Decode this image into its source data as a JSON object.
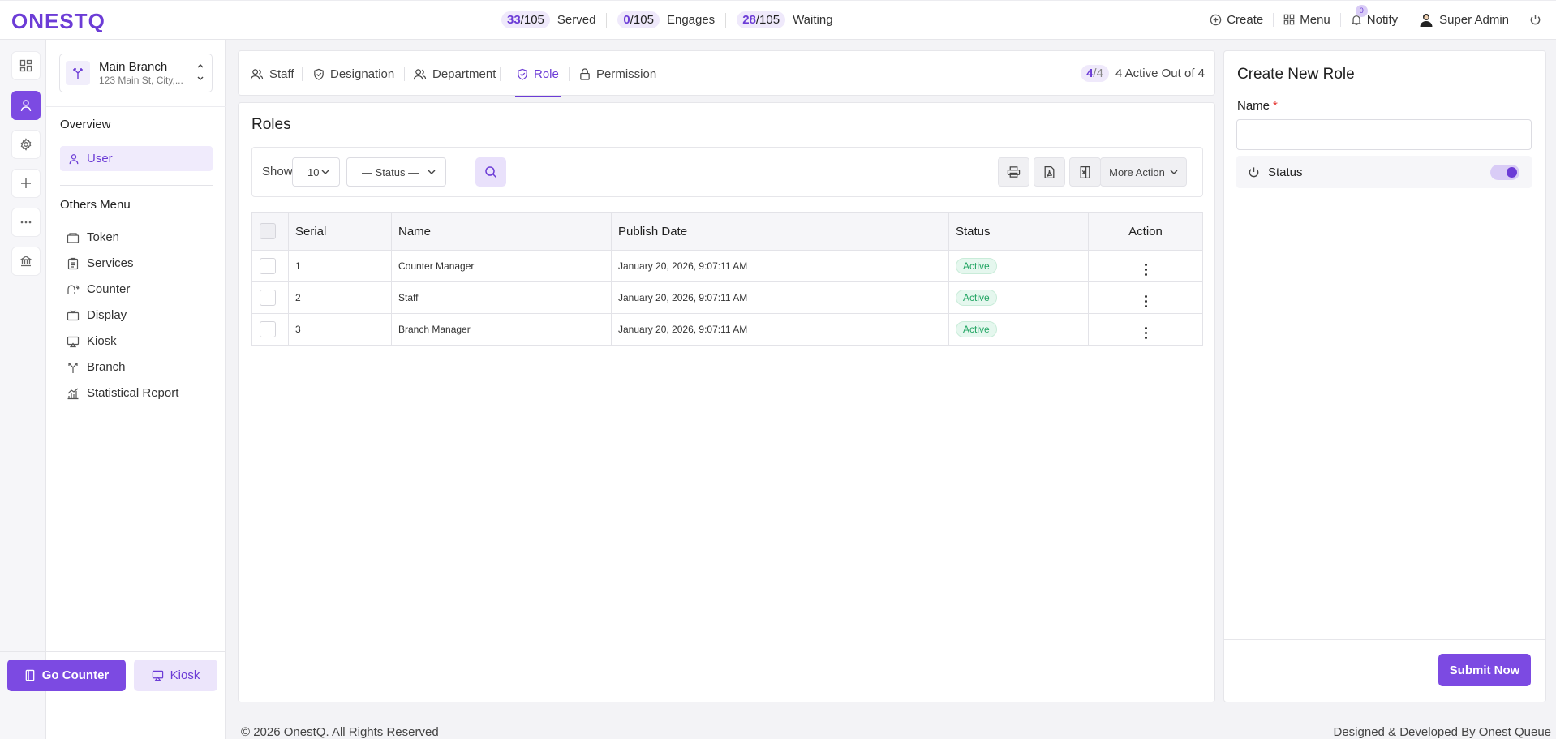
{
  "brand": {
    "logo": "ONESTQ",
    "accent": "#6c3cd6"
  },
  "stats": [
    {
      "value": "33",
      "total": "/105",
      "label": "Served"
    },
    {
      "value": "0",
      "total": "/105",
      "label": "Engages"
    },
    {
      "value": "28",
      "total": "/105",
      "label": "Waiting"
    }
  ],
  "topnav": {
    "create": "Create",
    "menu": "Menu",
    "notify": "Notify",
    "notify_count": "0",
    "user": "Super Admin"
  },
  "branch": {
    "name": "Main Branch",
    "address": "123 Main St, City,..."
  },
  "sidebar": {
    "overview_heading": "Overview",
    "user_item": "User",
    "others_heading": "Others Menu",
    "items": [
      {
        "label": "Token",
        "icon": "token-icon"
      },
      {
        "label": "Services",
        "icon": "clipboard-icon"
      },
      {
        "label": "Counter",
        "icon": "counter-icon"
      },
      {
        "label": "Display",
        "icon": "tv-icon"
      },
      {
        "label": "Kiosk",
        "icon": "kiosk-icon"
      },
      {
        "label": "Branch",
        "icon": "branch-icon"
      },
      {
        "label": "Statistical Report",
        "icon": "chart-icon"
      }
    ],
    "go_counter": "Go Counter",
    "kiosk": "Kiosk"
  },
  "tabs": [
    {
      "label": "Staff",
      "active": false
    },
    {
      "label": "Designation",
      "active": false
    },
    {
      "label": "Department",
      "active": false
    },
    {
      "label": "Role",
      "active": true
    },
    {
      "label": "Permission",
      "active": false
    }
  ],
  "active_count": {
    "current": "4",
    "total": "/4",
    "text": "4 Active Out of 4"
  },
  "roles": {
    "title": "Roles",
    "show_label": "Show",
    "page_size": "10",
    "status_filter": "— Status —",
    "more_action": "More Action",
    "columns": [
      "Serial",
      "Name",
      "Publish Date",
      "Status",
      "Action"
    ],
    "rows": [
      {
        "serial": "1",
        "name": "Counter Manager",
        "date": "January 20, 2026, 9:07:11 AM",
        "status": "Active"
      },
      {
        "serial": "2",
        "name": "Staff",
        "date": "January 20, 2026, 9:07:11 AM",
        "status": "Active"
      },
      {
        "serial": "3",
        "name": "Branch Manager",
        "date": "January 20, 2026, 9:07:11 AM",
        "status": "Active"
      }
    ]
  },
  "create_role": {
    "title": "Create New Role",
    "name_label": "Name",
    "required_mark": "*",
    "status_label": "Status",
    "status_on": true,
    "submit": "Submit Now"
  },
  "footer": {
    "left": "© 2026 OnestQ. All Rights Reserved",
    "right": "Designed & Developed By Onest Queue"
  }
}
